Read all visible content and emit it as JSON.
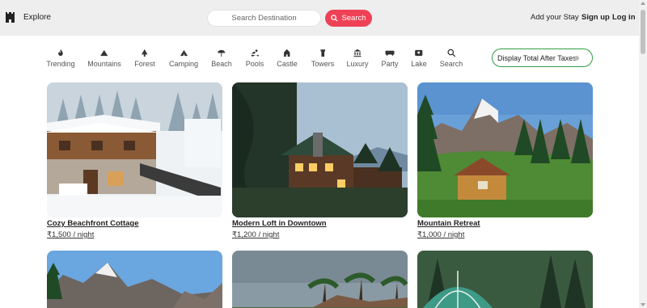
{
  "header": {
    "explore_label": "Explore",
    "search_placeholder": "Search Destination",
    "search_button_label": "Search",
    "add_stay_label": "Add your Stay",
    "signup_label": "Sign up",
    "login_label": "Log in"
  },
  "categories": [
    {
      "label": "Trending",
      "icon": "fire-icon"
    },
    {
      "label": "Mountains",
      "icon": "mountain-icon"
    },
    {
      "label": "Forest",
      "icon": "tree-icon"
    },
    {
      "label": "Camping",
      "icon": "tent-icon"
    },
    {
      "label": "Beach",
      "icon": "umbrella-icon"
    },
    {
      "label": "Pools",
      "icon": "swimmer-icon"
    },
    {
      "label": "Castle",
      "icon": "castle-icon"
    },
    {
      "label": "Towers",
      "icon": "tower-icon"
    },
    {
      "label": "Luxury",
      "icon": "bank-icon"
    },
    {
      "label": "Party",
      "icon": "gamepad-icon"
    },
    {
      "label": "Lake",
      "icon": "lake-icon"
    },
    {
      "label": "Search",
      "icon": "search-icon"
    }
  ],
  "tax_toggle": {
    "label": "Display Total After Taxes",
    "enabled": false
  },
  "listings": [
    {
      "title": "Cozy Beachfront Cottage",
      "price": "₹1,500 / night"
    },
    {
      "title": "Modern Loft in Downtown",
      "price": "₹1,200 / night"
    },
    {
      "title": "Mountain Retreat",
      "price": "₹1,000 / night"
    }
  ],
  "colors": {
    "accent": "#ef4156",
    "toggle_border": "#2ea043",
    "header_bg": "#eeeeee"
  }
}
